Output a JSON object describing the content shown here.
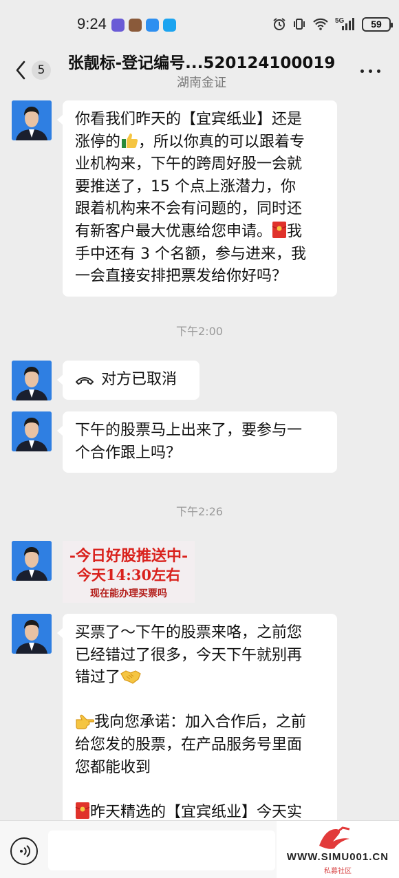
{
  "status_bar": {
    "time": "9:24",
    "battery": "59",
    "network": "5G"
  },
  "header": {
    "back_count": "5",
    "title": "张靓标-登记编号...520124100019",
    "subtitle": "湖南金证"
  },
  "messages": [
    {
      "type": "text",
      "lines": [
        "你看我们昨天的【宜宾纸业】还是",
        "涨停的",
        "，所以你真的可以跟着专",
        "业机构来，下午的跨周好股一会就",
        "要推送了，15 个点上涨潜力，你",
        "跟着机构来不会有问题的，同时还",
        "有新客户最大优惠给您申请。",
        "我",
        "手中还有 3 个名额，参与进来，我",
        "一会直接安排把票发给你好吗？"
      ]
    },
    {
      "type": "time",
      "text": "下午2:00"
    },
    {
      "type": "call",
      "text": "对方已取消"
    },
    {
      "type": "text",
      "lines": [
        "下午的股票马上出来了，要参与一",
        "个合作跟上吗？"
      ]
    },
    {
      "type": "time",
      "text": "下午2:26"
    },
    {
      "type": "image",
      "line1": "-今日好股推送中-",
      "line2": "今天14:30左右",
      "line3": "现在能办理买票吗"
    },
    {
      "type": "text",
      "lines": [
        "买票了～下午的股票来咯，之前您",
        "已经错过了很多，今天下午就别再",
        "错过了",
        "我向您承诺：加入合作后，之前",
        "给您发的股票，在产品服务号里面",
        "您都能收到",
        "昨天精选的【宜宾纸业】今天实"
      ]
    }
  ],
  "watermark": {
    "text": "WWW.SIMU001.CN",
    "sub": "私募社区"
  },
  "icons": {
    "back": "chevron-left-icon",
    "more": "more-dots-icon",
    "voice": "voice-icon",
    "thumbs_up": "thumbs-up-icon",
    "red_envelope": "red-envelope-icon",
    "handshake": "handshake-icon",
    "pointing_hand": "pointing-right-icon",
    "phone_hangup": "phone-hangup-icon"
  },
  "colors": {
    "background": "#ededed",
    "bubble": "#ffffff",
    "promo_red": "#d9211c",
    "avatar_bg": "#2f7fe2"
  }
}
